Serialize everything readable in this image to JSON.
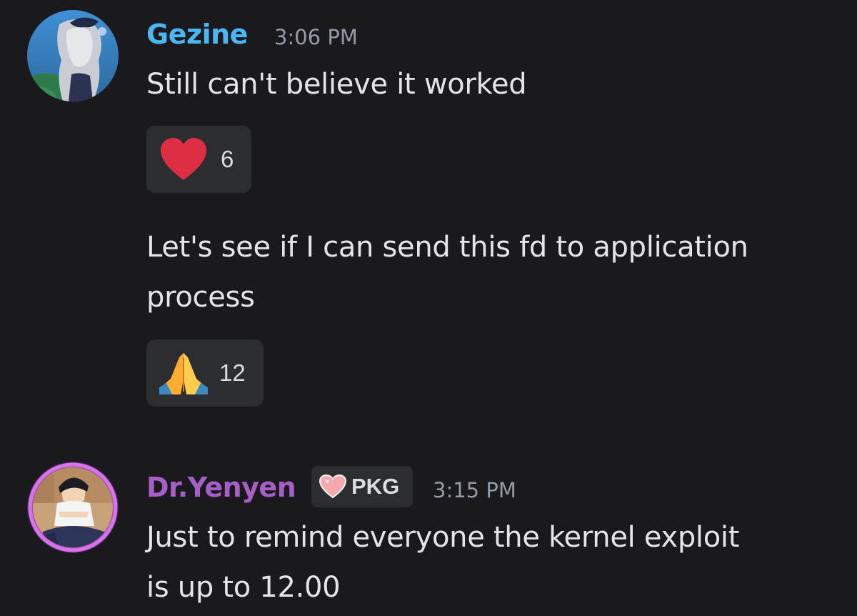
{
  "messages": [
    {
      "username": "Gezine",
      "username_color": "#4ab6f2",
      "timestamp": "3:06 PM",
      "avatar_icon": "anime-girl-avatar",
      "lines": [
        {
          "text": "Still can't believe it worked",
          "reaction": {
            "emoji": "heart-icon",
            "count": "6"
          }
        },
        {
          "text": "Let's see if I can send this fd to application",
          "text2": "process",
          "reaction": {
            "emoji": "folded-hands-icon",
            "count": "12"
          }
        }
      ]
    },
    {
      "username": "Dr.Yenyen",
      "username_color": "#a65fc4",
      "timestamp": "3:15 PM",
      "avatar_icon": "anime-boy-avatar",
      "tag": {
        "icon": "pixel-heart-icon",
        "label": "PKG"
      },
      "lines": [
        {
          "text": "Just to remind everyone the kernel exploit",
          "text2": "is up to 12.00"
        }
      ]
    }
  ]
}
